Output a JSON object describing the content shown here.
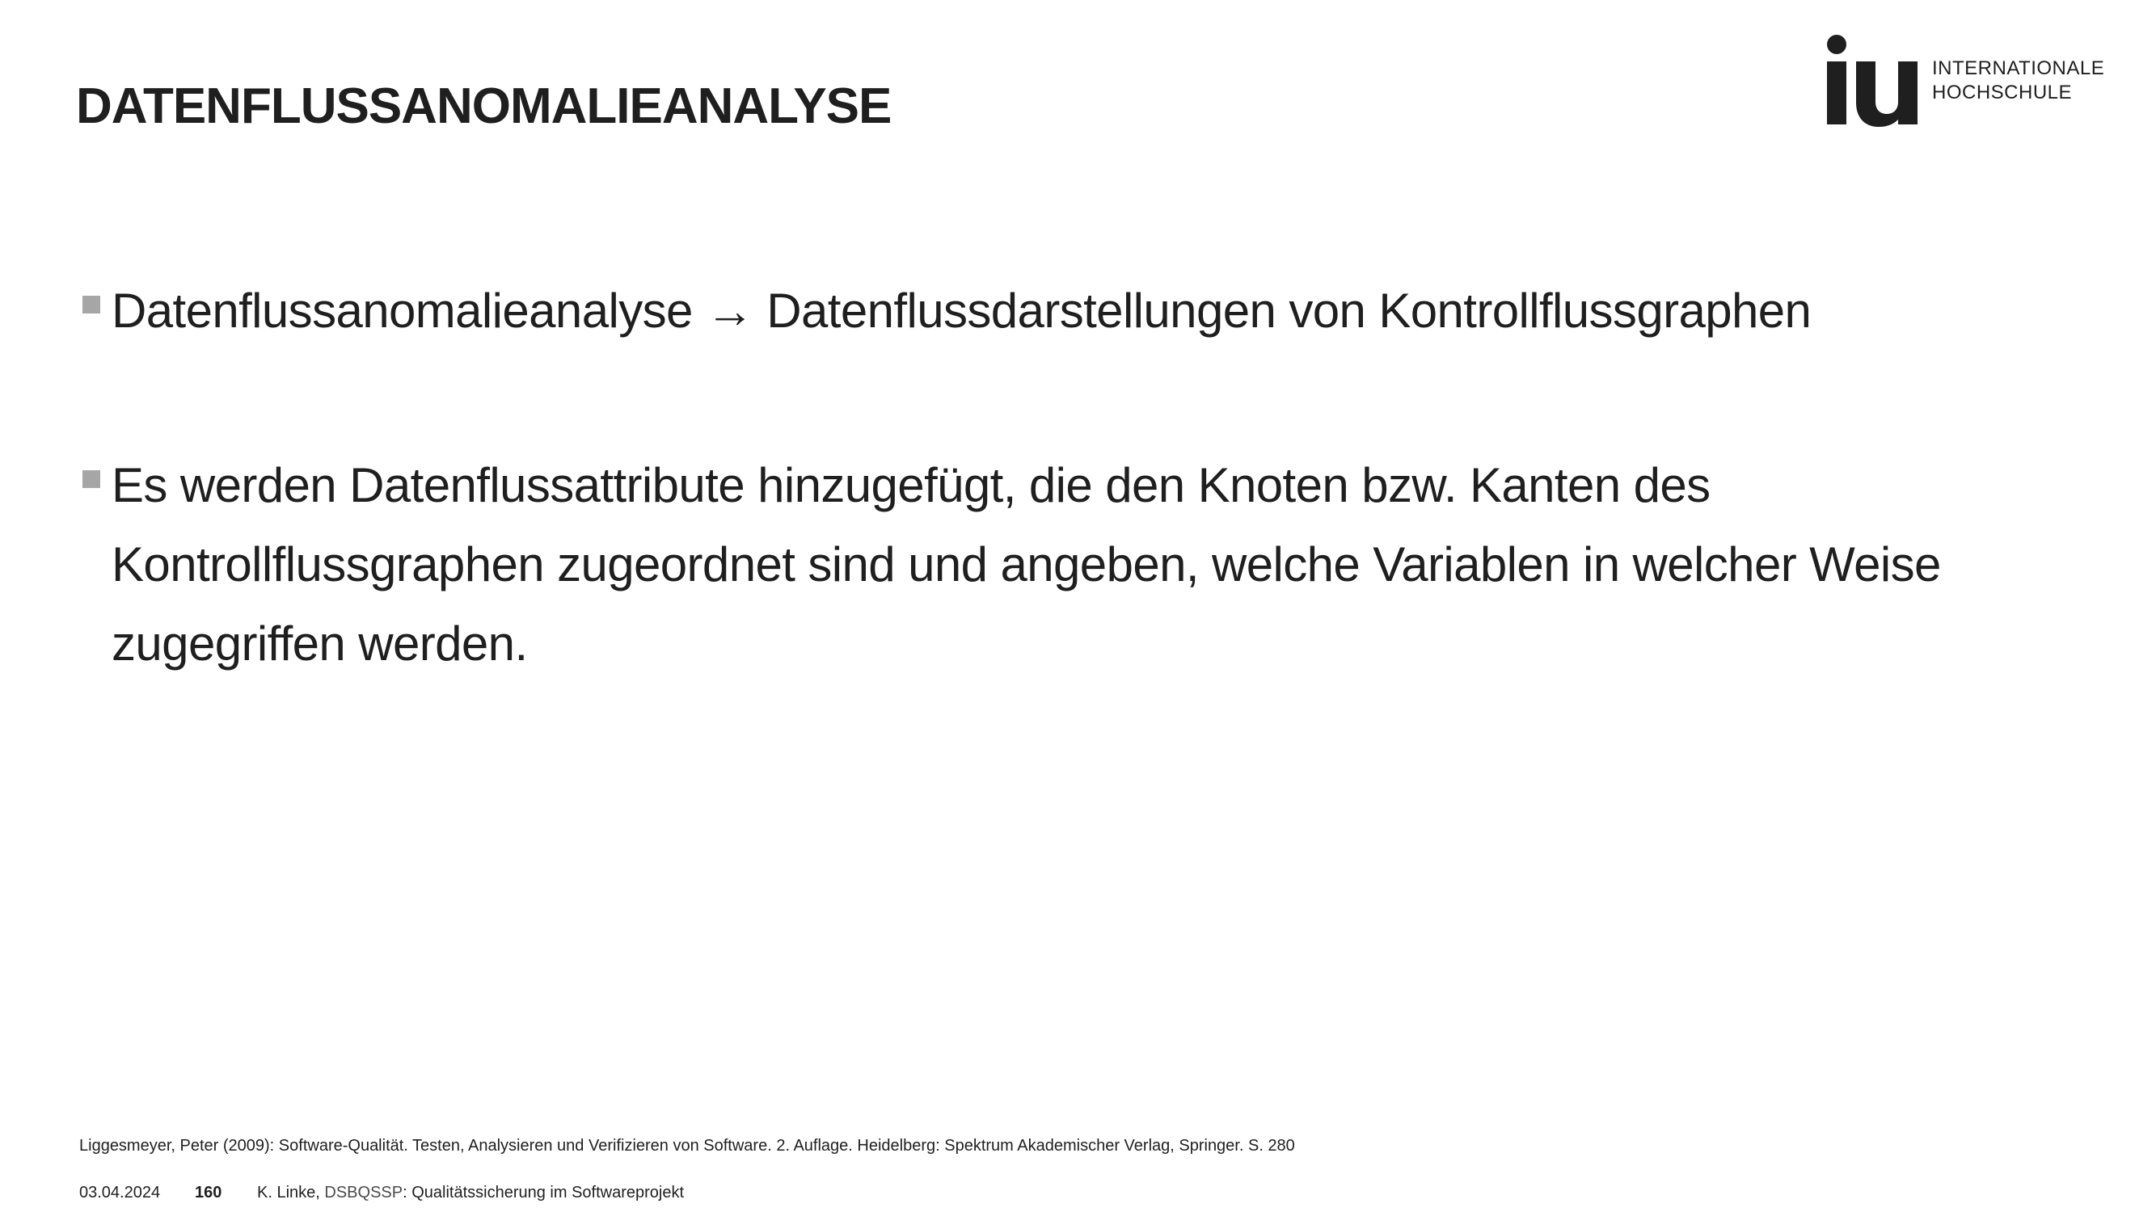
{
  "slide": {
    "title": "DATENFLUSSANOMALIEANALYSE",
    "bullets": [
      {
        "text": "Datenflussanomalieanalyse → Datenflussdarstellungen von Kontrollflussgraphen"
      },
      {
        "text": "Es werden Datenflussattribute hinzugefügt, die den Knoten bzw. Kanten des Kontrollflussgraphen zugeordnet sind und angeben, welche Variablen in welcher Weise zugegriffen werden."
      }
    ],
    "citation": "Liggesmeyer, Peter (2009): Software-Qualität. Testen, Analysieren und Verifizieren von Software. 2. Auflage. Heidelberg: Spektrum Akademischer Verlag, Springer. S. 280"
  },
  "logo": {
    "mark": "iu",
    "line1": "INTERNATIONALE",
    "line2": "HOCHSCHULE"
  },
  "footer": {
    "date": "03.04.2024",
    "page_number": "160",
    "author": "K. Linke, ",
    "course_code": "DSBQSSP",
    "course_title": ": Qualitätssicherung im Softwareprojekt"
  },
  "colors": {
    "text": "#1f1f1f",
    "bullet_marker": "#a6a6a6",
    "background": "#ffffff"
  }
}
